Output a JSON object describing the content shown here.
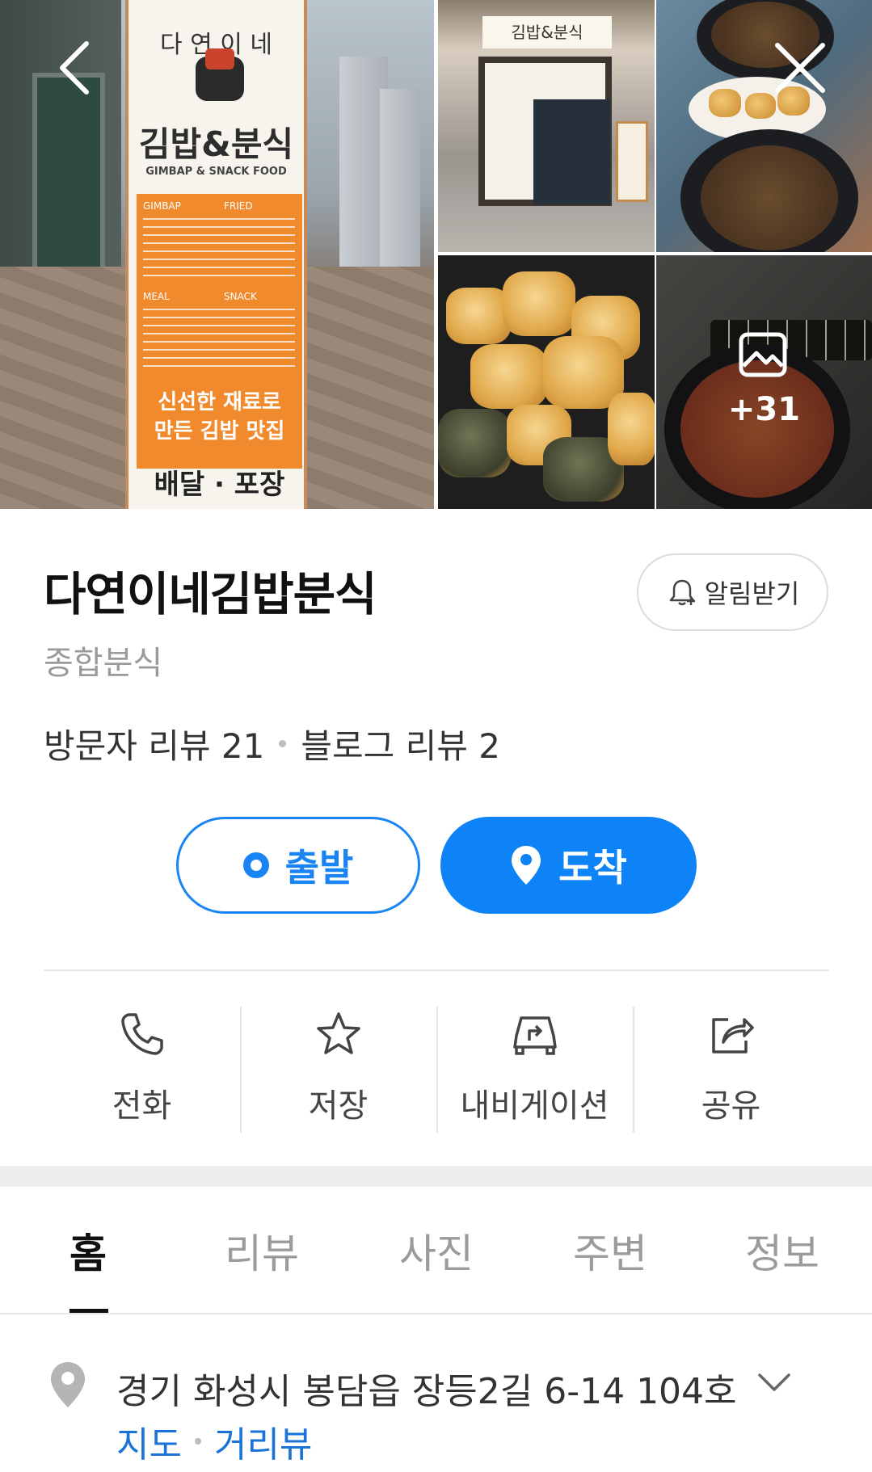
{
  "gallery": {
    "banner_brand": "다 연 이 네",
    "banner_title": "김밥&분식",
    "banner_subtitle": "GIMBAP & SNACK FOOD",
    "banner_menu_headers": [
      "GIMBAP",
      "FRIED",
      "MEAL",
      "SNACK"
    ],
    "banner_slogan_1": "신선한 재료로",
    "banner_slogan_2": "만든 김밥 맛집",
    "banner_delivery": "배달 · 포장",
    "store_sign": "김밥&분식",
    "more_photos": "+31"
  },
  "place": {
    "name": "다연이네김밥분식",
    "category": "종합분식",
    "alert_label": "알림받기",
    "visitor_reviews": "방문자 리뷰 21",
    "blog_reviews": "블로그 리뷰 2"
  },
  "route": {
    "start_label": "출발",
    "arrive_label": "도착"
  },
  "actions": {
    "call": "전화",
    "save": "저장",
    "navigation": "내비게이션",
    "share": "공유"
  },
  "tabs": {
    "home": "홈",
    "review": "리뷰",
    "photo": "사진",
    "nearby": "주변",
    "info": "정보"
  },
  "address": {
    "text": "경기 화성시 봉담읍 장등2길 6-14 104호",
    "map_link": "지도",
    "streetview_link": "거리뷰"
  },
  "colors": {
    "accent": "#0d83f7",
    "link": "#1a73d9"
  }
}
